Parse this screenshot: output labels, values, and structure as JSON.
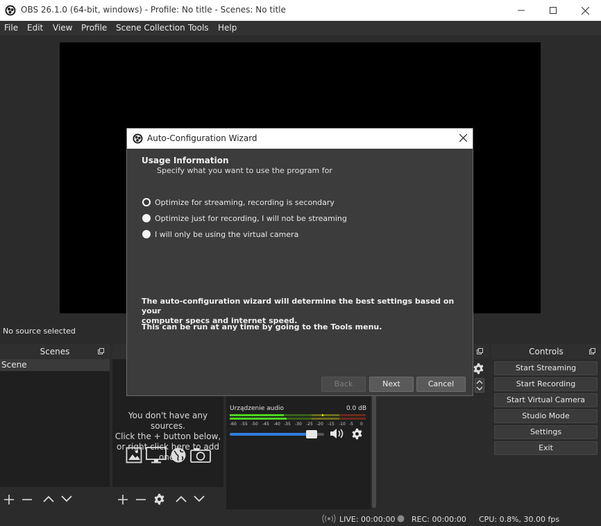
{
  "window": {
    "title": "OBS 26.1.0 (64-bit, windows) - Profile: No title - Scenes: No title"
  },
  "menu": [
    "File",
    "Edit",
    "View",
    "Profile",
    "Scene Collection",
    "Tools",
    "Help"
  ],
  "source_status": "No source selected",
  "scenes": {
    "title": "Scenes",
    "items": [
      "Scene"
    ]
  },
  "sources": {
    "empty_line1": "You don't have any sources.",
    "empty_line2": "Click the + button below,",
    "empty_line3": "or right click here to add one."
  },
  "mixer": {
    "device": "Urządzenie audio",
    "level": "0.0 dB",
    "ticks": [
      "-60",
      "-55",
      "-50",
      "-45",
      "-40",
      "-35",
      "-30",
      "-25",
      "-20",
      "-15",
      "-10",
      "-5",
      "0"
    ],
    "volume_fraction": 0.93
  },
  "controls": {
    "title": "Controls",
    "buttons": [
      "Start Streaming",
      "Start Recording",
      "Start Virtual Camera",
      "Studio Mode",
      "Settings",
      "Exit"
    ]
  },
  "dialog": {
    "title": "Auto-Configuration Wizard",
    "heading": "Usage Information",
    "subheading": "Specify what you want to use the program for",
    "options": [
      "Optimize for streaming, recording is secondary",
      "Optimize just for recording, I will not be streaming",
      "I will only be using the virtual camera"
    ],
    "info1_line1": "The auto-configuration wizard will determine the best settings based on your",
    "info1_line2": "computer specs and internet speed.",
    "info2": "This can be run at any time by going to the Tools menu.",
    "back": "Back",
    "next": "Next",
    "cancel": "Cancel"
  },
  "status": {
    "live": "LIVE: 00:00:00",
    "rec": "REC: 00:00:00",
    "cpu": "CPU: 0.8%, 30.00 fps"
  }
}
